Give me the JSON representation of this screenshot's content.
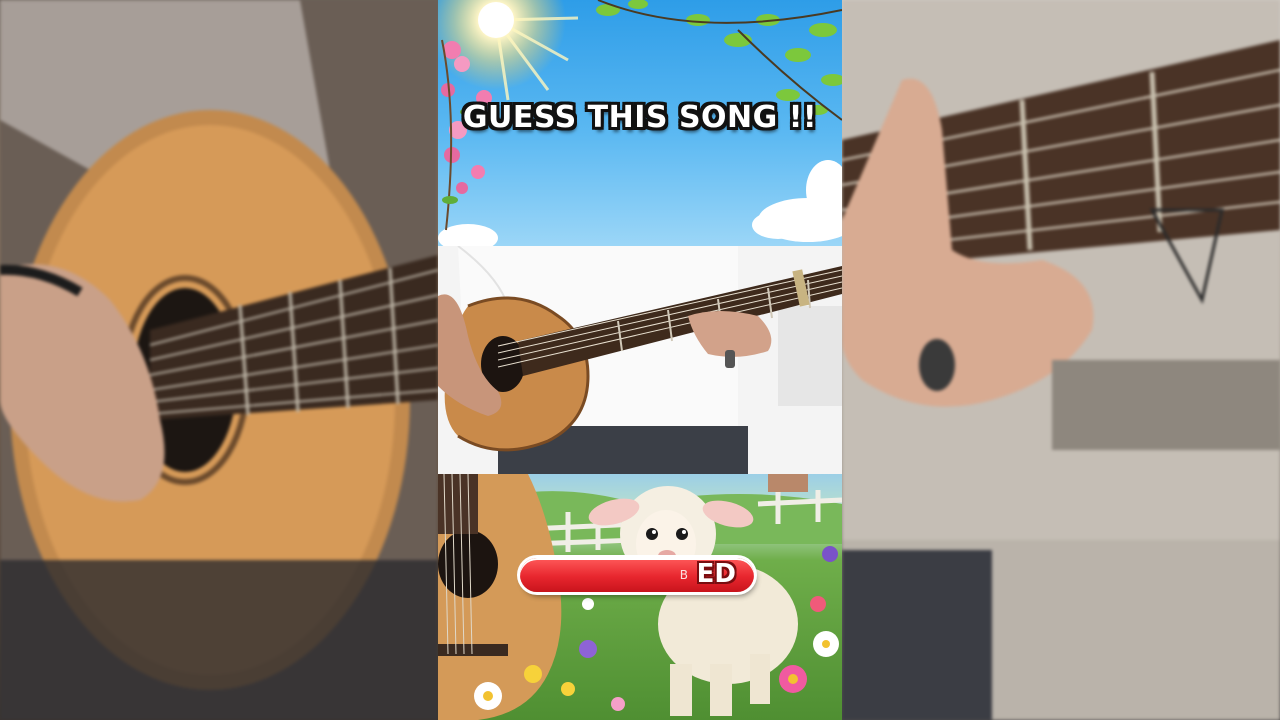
{
  "title": "GUESS THIS SONG !!",
  "answer_reveal": {
    "hint_letter": "B",
    "visible_text": "ED"
  },
  "colors": {
    "sky": "#2e9de8",
    "title_text": "#ffffff",
    "title_outline": "#111111",
    "answer_bar": "#e8262e"
  },
  "icons": [
    "sun-icon",
    "leaf-cluster-icon",
    "flower-icon",
    "cloud-icon",
    "guitar-icon",
    "lamb-icon",
    "fence-icon"
  ]
}
